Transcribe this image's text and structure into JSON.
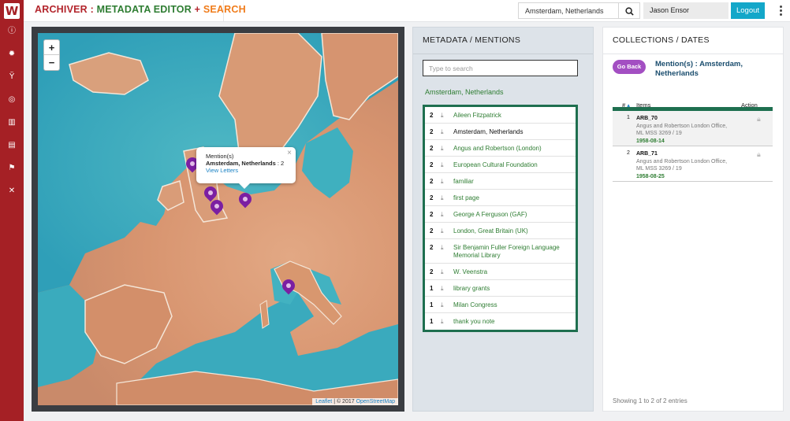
{
  "app": {
    "brand_part1": "ARCHIVER",
    "brand_sep1": " : ",
    "brand_part2": "METADATA EDITOR",
    "brand_sep2": " + ",
    "brand_part3": "SEARCH",
    "colors": {
      "sidebar": "#a52025",
      "accent_green": "#2e7d32",
      "accent_orange": "#f07c1b",
      "logout": "#13a7c9",
      "pin": "#7b1fa2",
      "goback": "#a34fc2"
    }
  },
  "sidebar": {
    "logo": "W",
    "icons": [
      "info-icon",
      "gear-icon",
      "branch-icon",
      "globe-icon",
      "map-icon",
      "document-icon",
      "flag-icon",
      "tools-icon"
    ]
  },
  "header": {
    "search_value": "Amsterdam, Netherlands",
    "user_name": "Jason Ensor",
    "logout_label": "Logout"
  },
  "map": {
    "zoom_in": "+",
    "zoom_out": "−",
    "popup": {
      "line1": "Mention(s)",
      "place": "Amsterdam, Netherlands",
      "count_text": " : 2",
      "link": "View Letters",
      "close": "×"
    },
    "attribution_leaflet": "Leaflet",
    "attribution_text": " | © 2017 ",
    "attribution_osm": "OpenStreetMap"
  },
  "metadata": {
    "title": "METADATA / MENTIONS",
    "search_placeholder": "Type to search",
    "selected_place": "Amsterdam, Netherlands",
    "rows": [
      {
        "count": "2",
        "label": "Aileen Fitzpatrick"
      },
      {
        "count": "2",
        "label": "Amsterdam, Netherlands"
      },
      {
        "count": "2",
        "label": "Angus and Robertson (London)"
      },
      {
        "count": "2",
        "label": "European Cultural Foundation"
      },
      {
        "count": "2",
        "label": "familiar"
      },
      {
        "count": "2",
        "label": "first page"
      },
      {
        "count": "2",
        "label": "George A Ferguson (GAF)"
      },
      {
        "count": "2",
        "label": "London, Great Britain (UK)"
      },
      {
        "count": "2",
        "label": "Sir Benjamin Fuller Foreign Language Memorial Library"
      },
      {
        "count": "2",
        "label": "W. Veenstra"
      },
      {
        "count": "1",
        "label": "library grants"
      },
      {
        "count": "1",
        "label": "Milan Congress"
      },
      {
        "count": "1",
        "label": "thank you note"
      }
    ]
  },
  "collections": {
    "title": "COLLECTIONS / DATES",
    "go_back": "Go Back",
    "mention_title": "Mention(s) : Amsterdam, Netherlands",
    "columns": {
      "num": "#",
      "items": "Items",
      "action": "Action"
    },
    "rows": [
      {
        "num": "1",
        "id": "ARB_70",
        "line1": "Angus and Robertson London Office,",
        "line2": "ML MSS 3269 / 19",
        "date": "1958-08-14"
      },
      {
        "num": "2",
        "id": "ARB_71",
        "line1": "Angus and Robertson London Office,",
        "line2": "ML MSS 3269 / 19",
        "date": "1958-08-25"
      }
    ],
    "info": "Showing 1 to 2 of 2 entries"
  }
}
